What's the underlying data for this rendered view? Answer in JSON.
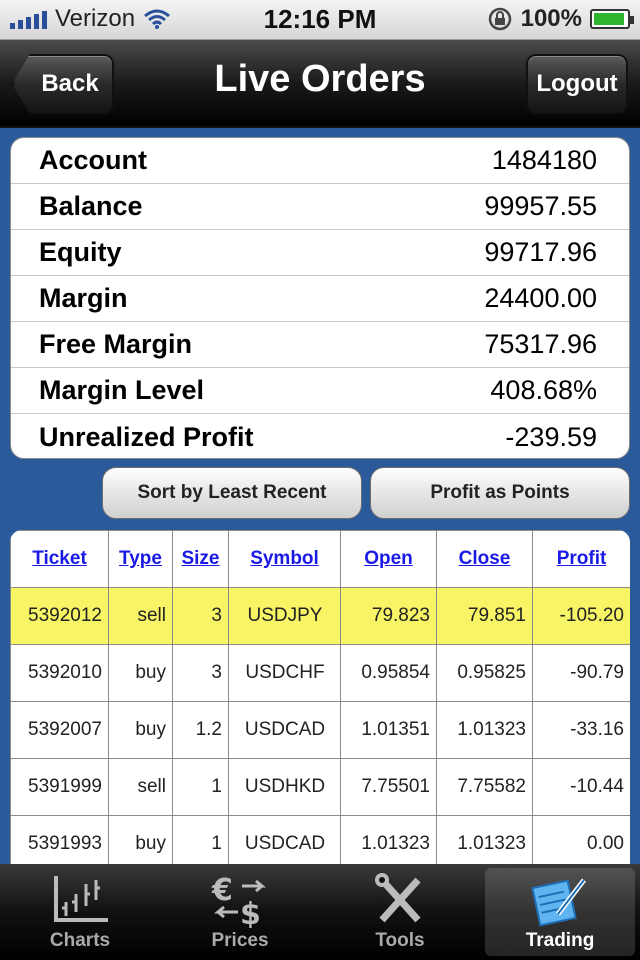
{
  "status": {
    "carrier": "Verizon",
    "time": "12:16 PM",
    "battery": "100%"
  },
  "nav": {
    "title": "Live Orders",
    "back_label": "Back",
    "logout_label": "Logout"
  },
  "account": [
    {
      "label": "Account",
      "value": "1484180"
    },
    {
      "label": "Balance",
      "value": "99957.55"
    },
    {
      "label": "Equity",
      "value": "99717.96"
    },
    {
      "label": "Margin",
      "value": "24400.00"
    },
    {
      "label": "Free Margin",
      "value": "75317.96"
    },
    {
      "label": "Margin Level",
      "value": "408.68%"
    },
    {
      "label": "Unrealized Profit",
      "value": "-239.59"
    }
  ],
  "buttons": {
    "sort": "Sort by Least Recent",
    "profit": "Profit as Points"
  },
  "orders": {
    "headers": [
      "Ticket",
      "Type",
      "Size",
      "Symbol",
      "Open",
      "Close",
      "Profit"
    ],
    "highlight_color": "#f7f466",
    "rows": [
      [
        "5392012",
        "sell",
        "3",
        "USDJPY",
        "79.823",
        "79.851",
        "-105.20"
      ],
      [
        "5392010",
        "buy",
        "3",
        "USDCHF",
        "0.95854",
        "0.95825",
        "-90.79"
      ],
      [
        "5392007",
        "buy",
        "1.2",
        "USDCAD",
        "1.01351",
        "1.01323",
        "-33.16"
      ],
      [
        "5391999",
        "sell",
        "1",
        "USDHKD",
        "7.75501",
        "7.75582",
        "-10.44"
      ],
      [
        "5391993",
        "buy",
        "1",
        "USDCAD",
        "1.01323",
        "1.01323",
        "0.00"
      ]
    ]
  },
  "tabs": [
    {
      "label": "Charts",
      "icon": "chart-icon"
    },
    {
      "label": "Prices",
      "icon": "currency-icon"
    },
    {
      "label": "Tools",
      "icon": "tools-icon"
    },
    {
      "label": "Trading",
      "icon": "trading-icon",
      "active": true
    }
  ]
}
